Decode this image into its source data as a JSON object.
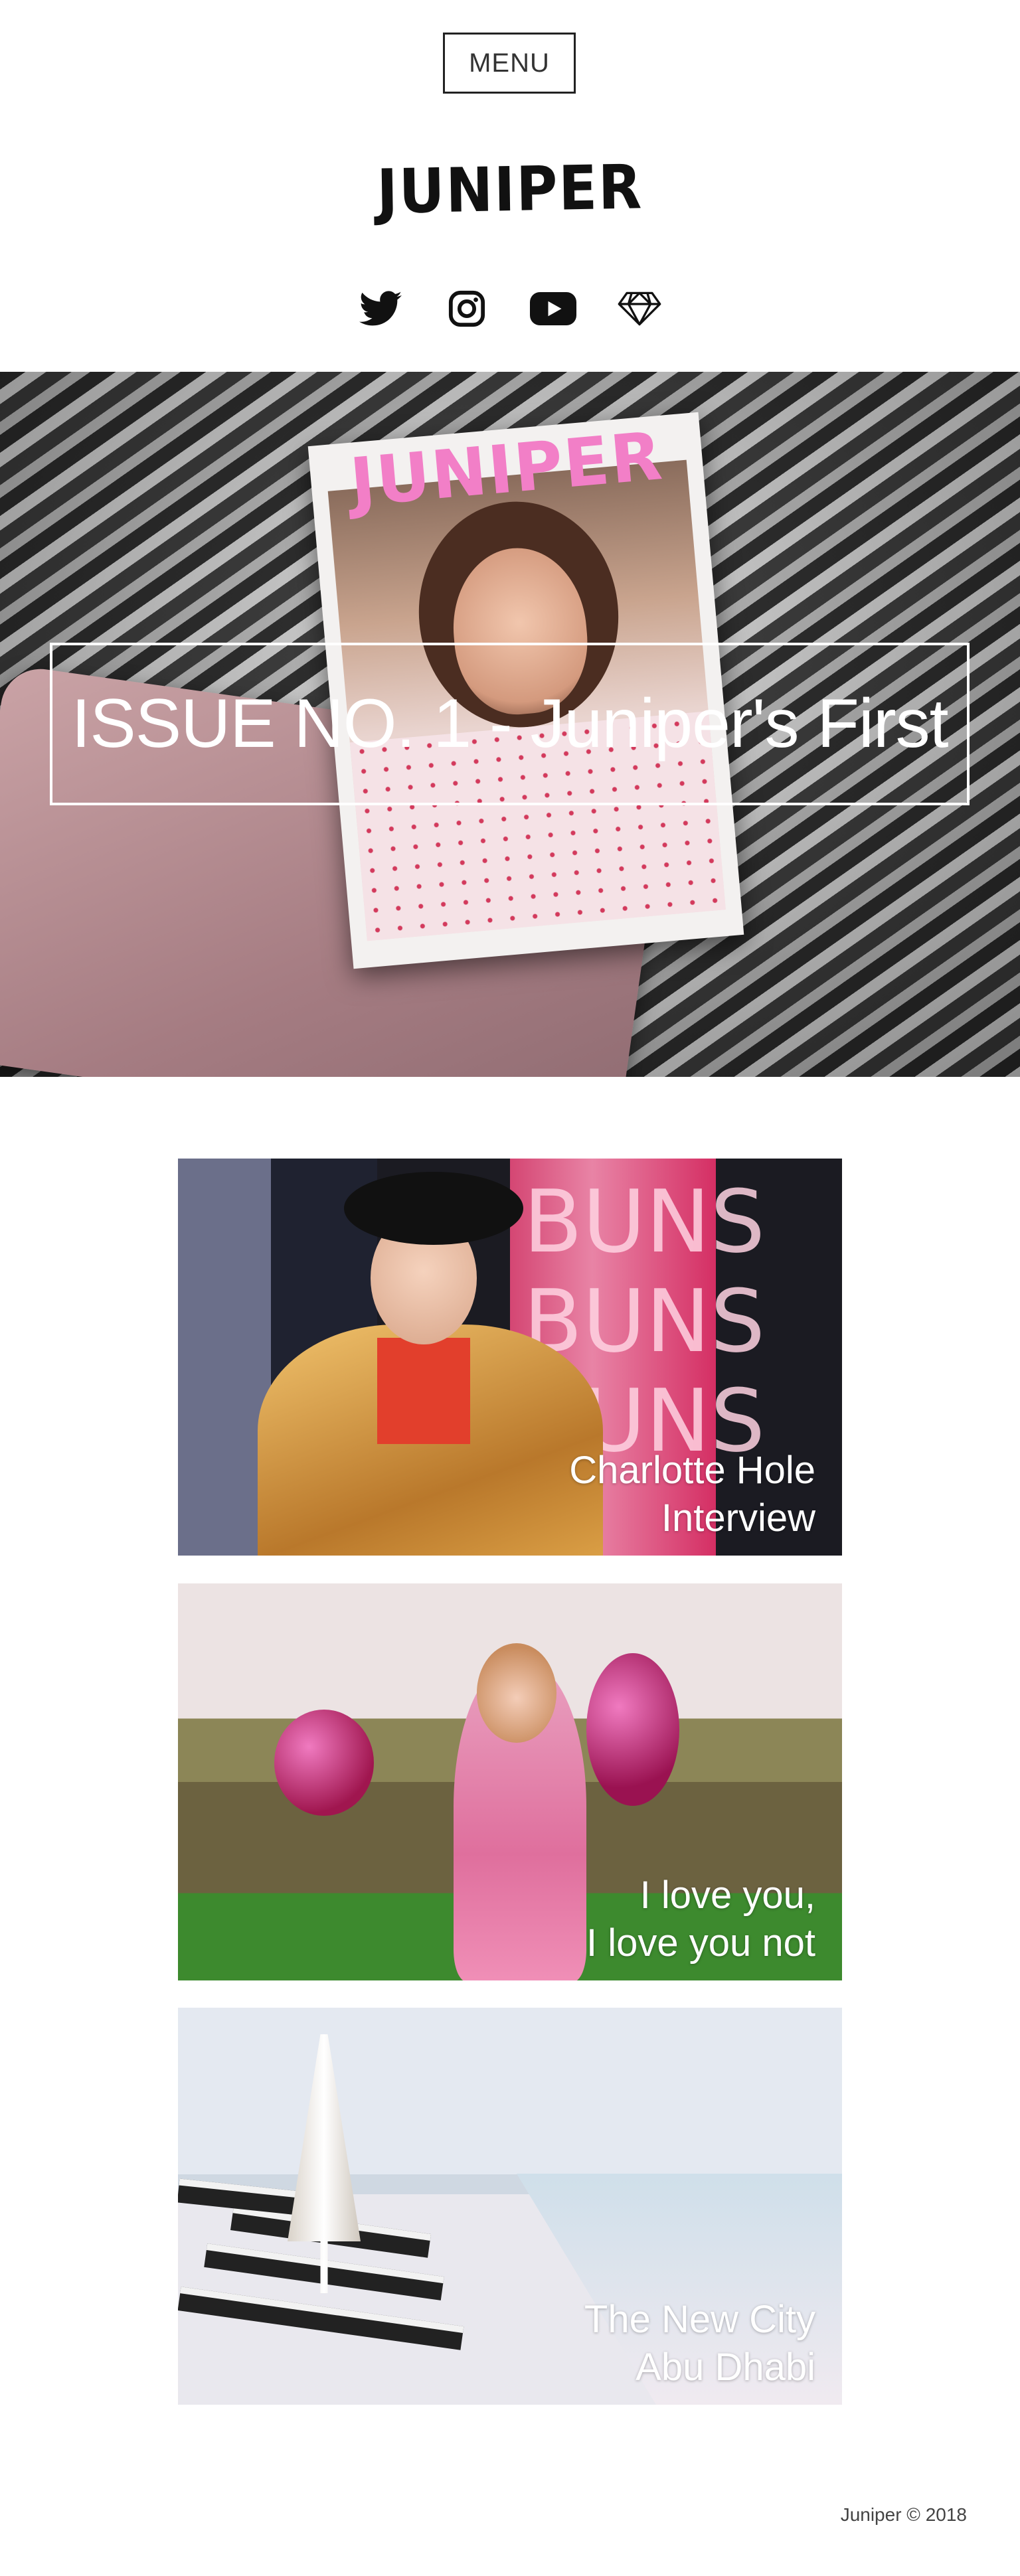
{
  "header": {
    "menu_label": "MENU",
    "logo_text": "JUNIPER",
    "social_icons": [
      "twitter-icon",
      "instagram-icon",
      "youtube-icon",
      "gem-icon"
    ]
  },
  "hero": {
    "title": "ISSUE NO. 1 - Juniper's First",
    "magazine_cover_title": "JUNIPER"
  },
  "articles": [
    {
      "line1": "Charlotte Hole",
      "line2": "Interview"
    },
    {
      "line1": "I love you,",
      "line2": "I love you not"
    },
    {
      "line1": "The New City",
      "line2": "Abu Dhabi"
    }
  ],
  "neon_sign": "BUNS\nBUNS\nBUNS",
  "footer": {
    "copyright": "Juniper © 2018"
  }
}
